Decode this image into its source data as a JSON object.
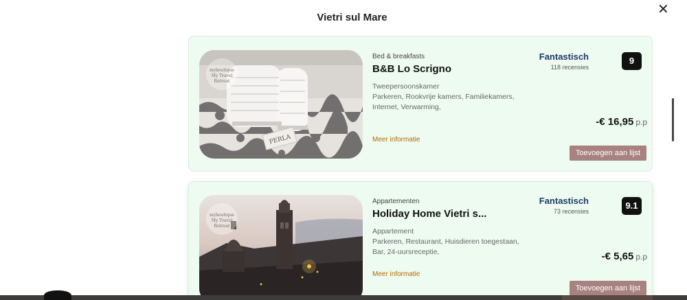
{
  "modal": {
    "title": "Vietri sul Mare"
  },
  "listings": [
    {
      "category": "Bed & breakfasts",
      "name": "B&B Lo Scrigno",
      "room_type": "Tweepersoonskamer",
      "amenities": "Parkeren, Rookvrije kamers, Familiekamers, Internet, Verwarming,",
      "more_info": "Meer informatie",
      "rating_word": "Fantastisch",
      "review_count": "118 recensies",
      "score": "9",
      "price": "-€ 16,95",
      "price_unit": "p.p",
      "add_button": "Toevoegen aan lijst",
      "photo_watermark": "PERLA"
    },
    {
      "category": "Appartementen",
      "name": "Holiday Home Vietri s...",
      "room_type": "Appartement",
      "amenities": "Parkeren, Restaurant, Huisdieren toegestaan, Bar, 24-uursreceptie,",
      "more_info": "Meer informatie",
      "rating_word": "Fantastisch",
      "review_count": "73 recensies",
      "score": "9.1",
      "price": "-€ 5,65",
      "price_unit": "p.p",
      "add_button": "Toevoegen aan lijst"
    }
  ]
}
